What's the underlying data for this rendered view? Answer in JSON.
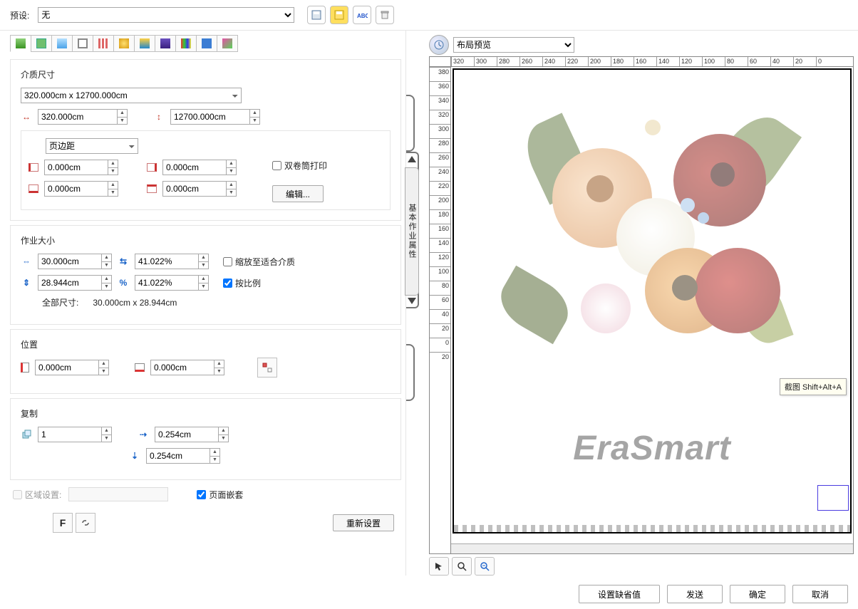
{
  "preset": {
    "label": "预设:",
    "value": "无"
  },
  "topButtons": [
    "save-icon",
    "save-as-icon",
    "abc-icon",
    "trash-icon"
  ],
  "previewDropdown": {
    "value": "布局预览"
  },
  "media": {
    "title": "介质尺寸",
    "sizePreset": "320.000cm x 12700.000cm",
    "width": "320.000cm",
    "height": "12700.000cm",
    "marginType": "页边距",
    "marginLeft": "0.000cm",
    "marginRight": "0.000cm",
    "marginTop": "0.000cm",
    "marginBottom": "0.000cm",
    "doubleRoll": "双卷筒打印",
    "editBtn": "编辑..."
  },
  "jobSize": {
    "title": "作业大小",
    "w": "30.000cm",
    "h": "28.944cm",
    "wPct": "41.022%",
    "hPct": "41.022%",
    "fit": "缩放至适合介质",
    "keepRatio": "按比例",
    "allLabel": "全部尺寸:",
    "allValue": "30.000cm x 28.944cm"
  },
  "position": {
    "title": "位置",
    "x": "0.000cm",
    "y": "0.000cm"
  },
  "copy": {
    "title": "复制",
    "count": "1",
    "gapX": "0.254cm",
    "gapY": "0.254cm"
  },
  "region": {
    "label": "区域设置:",
    "nest": "页面嵌套",
    "reset": "重新设置"
  },
  "sideTab": "基本作业属性",
  "watermark": "EraSmart",
  "tooltip": "截图 Shift+Alt+A",
  "hruler": [
    "320",
    "300",
    "280",
    "260",
    "240",
    "220",
    "200",
    "180",
    "160",
    "140",
    "120",
    "100",
    "80",
    "60",
    "40",
    "20",
    "0"
  ],
  "vruler": [
    "380",
    "360",
    "340",
    "320",
    "300",
    "280",
    "260",
    "240",
    "220",
    "200",
    "180",
    "160",
    "140",
    "120",
    "100",
    "80",
    "60",
    "40",
    "20",
    "0",
    "20"
  ],
  "footer": {
    "setDefault": "设置缺省值",
    "send": "发送",
    "ok": "确定",
    "cancel": "取消"
  }
}
